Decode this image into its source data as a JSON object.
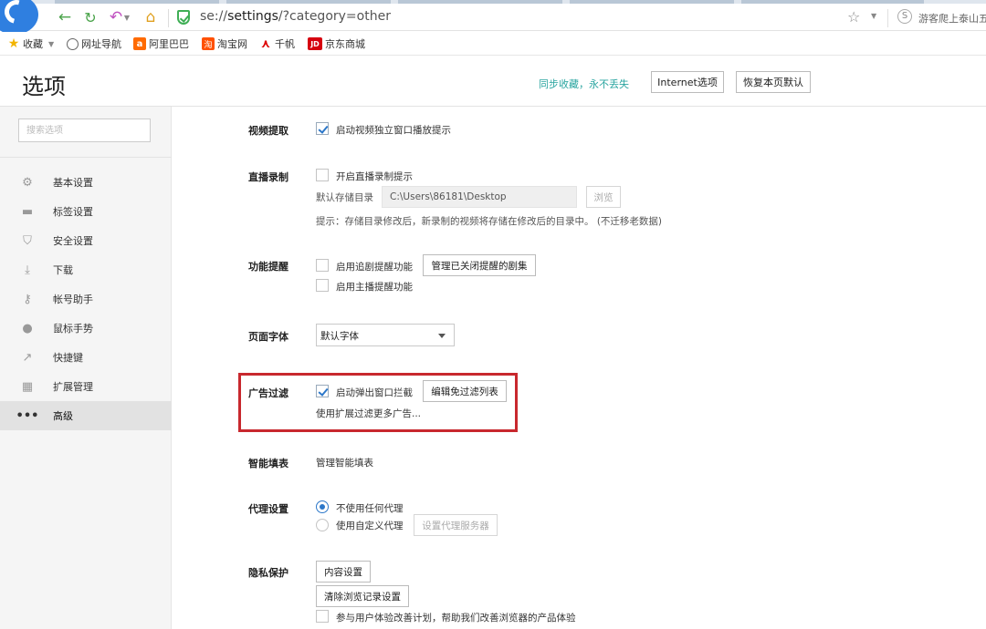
{
  "browser": {
    "url_prefix": "se://",
    "url_host": "settings",
    "url_rest": "/?category=other",
    "hot_search": "游客爬上泰山五",
    "search_engine_letter": "S",
    "colors": {
      "accent_green": "#3fae55",
      "brand_blue": "#2f7fe0"
    }
  },
  "bookmarks": [
    {
      "label": "收藏",
      "icon": "star-icon"
    },
    {
      "label": "网址导航",
      "icon": "globe-icon"
    },
    {
      "label": "阿里巴巴",
      "icon": "alibaba-icon",
      "glyph": "a"
    },
    {
      "label": "淘宝网",
      "icon": "taobao-icon",
      "glyph": "淘"
    },
    {
      "label": "千帆",
      "icon": "qianfan-icon",
      "glyph": "⋏"
    },
    {
      "label": "京东商城",
      "icon": "jd-icon",
      "glyph": "JD"
    }
  ],
  "header": {
    "title": "选项",
    "sync_text": "同步收藏，永不丢失",
    "internet_options": "Internet选项",
    "restore_defaults": "恢复本页默认"
  },
  "sidebar": {
    "search_placeholder": "搜索选项",
    "items": [
      {
        "label": "基本设置",
        "icon": "gear-icon"
      },
      {
        "label": "标签设置",
        "icon": "tab-icon"
      },
      {
        "label": "安全设置",
        "icon": "shield-icon"
      },
      {
        "label": "下载",
        "icon": "download-icon"
      },
      {
        "label": "帐号助手",
        "icon": "key-icon"
      },
      {
        "label": "鼠标手势",
        "icon": "mouse-icon"
      },
      {
        "label": "快捷键",
        "icon": "shortcut-icon"
      },
      {
        "label": "扩展管理",
        "icon": "extensions-icon"
      },
      {
        "label": "高级",
        "icon": "more-icon",
        "active": true
      }
    ]
  },
  "settings": {
    "video": {
      "label": "视频提取",
      "option": "启动视频独立窗口播放提示",
      "checked": true
    },
    "live_record": {
      "label": "直播录制",
      "option": "开启直播录制提示",
      "checked": false,
      "dir_label": "默认存储目录",
      "dir_value": "C:\\Users\\86181\\Desktop",
      "browse": "浏览",
      "hint": "提示：存储目录修改后，新录制的视频将存储在修改后的目录中。 (不迁移老数据)"
    },
    "reminder": {
      "label": "功能提醒",
      "option1": "启用追剧提醒功能",
      "option1_checked": false,
      "manage_button": "管理已关闭提醒的剧集",
      "option2": "启用主播提醒功能",
      "option2_checked": false
    },
    "font": {
      "label": "页面字体",
      "selected": "默认字体"
    },
    "adblock": {
      "label": "广告过滤",
      "option": "启动弹出窗口拦截",
      "checked": true,
      "edit_button": "编辑免过滤列表",
      "more_link": "使用扩展过滤更多广告..."
    },
    "autofill": {
      "label": "智能填表",
      "link": "管理智能填表"
    },
    "proxy": {
      "label": "代理设置",
      "option1": "不使用任何代理",
      "option1_checked": true,
      "option2": "使用自定义代理",
      "option2_checked": false,
      "server_button": "设置代理服务器"
    },
    "privacy": {
      "label": "隐私保护",
      "content_button": "内容设置",
      "clear_button": "清除浏览记录设置",
      "improve_option": "参与用户体验改善计划，帮助我们改善浏览器的产品体验",
      "improve_checked": false
    }
  },
  "annotation": {
    "highlight_color": "#c8282e"
  }
}
